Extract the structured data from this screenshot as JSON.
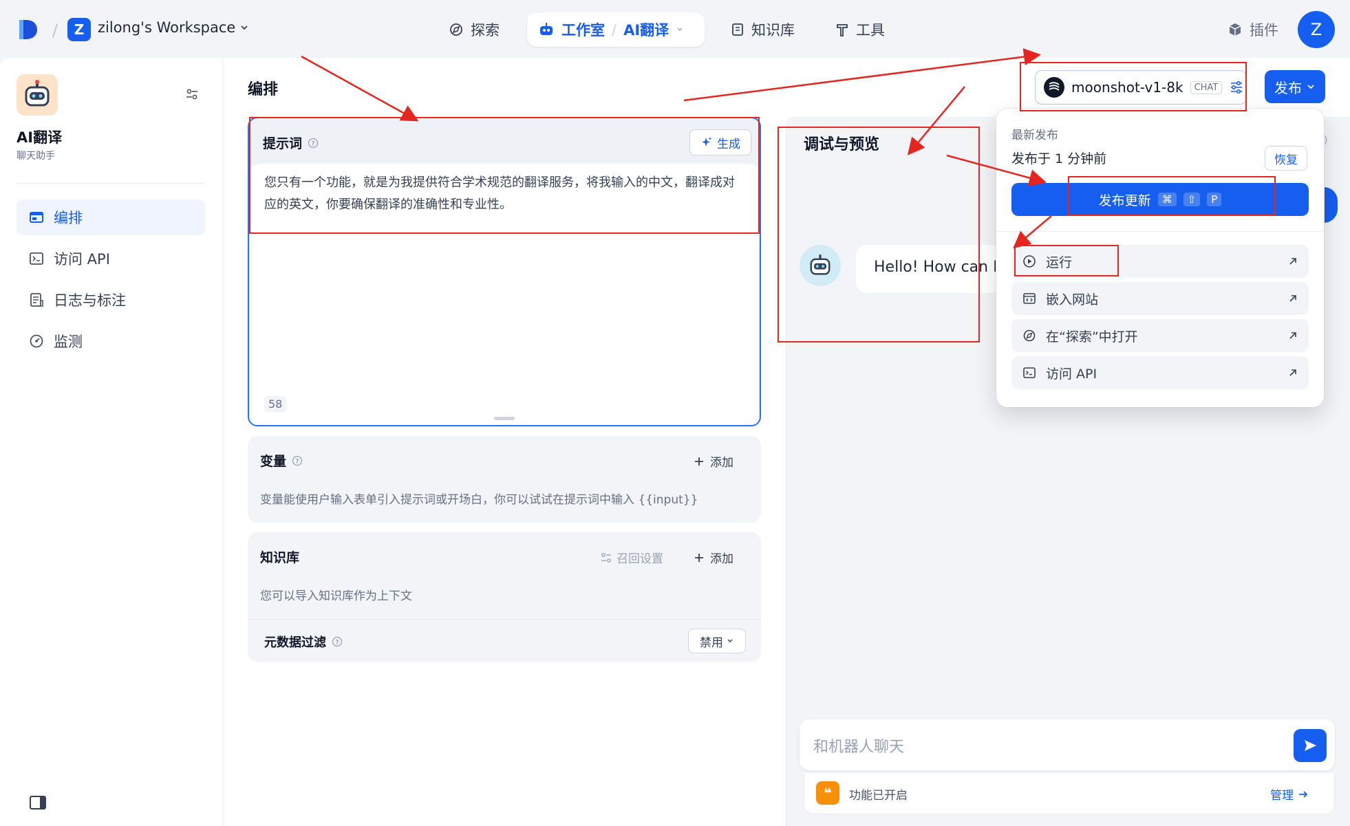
{
  "topbar": {
    "workspace_initial": "Z",
    "workspace_name": "zilong's Workspace",
    "nav_explore": "探索",
    "nav_studio": "工作室",
    "nav_app": "AI翻译",
    "nav_knowledge": "知识库",
    "nav_tools": "工具",
    "plugin": "插件",
    "user_initial": "Z"
  },
  "sidebar": {
    "app_name": "AI翻译",
    "app_type": "聊天助手",
    "items": [
      {
        "label": "编排",
        "icon": "layout-icon",
        "active": true
      },
      {
        "label": "访问 API",
        "icon": "terminal-icon",
        "active": false
      },
      {
        "label": "日志与标注",
        "icon": "logs-icon",
        "active": false
      },
      {
        "label": "监测",
        "icon": "gauge-icon",
        "active": false
      }
    ]
  },
  "main": {
    "title": "编排",
    "prompt": {
      "label": "提示词",
      "generate": "生成",
      "text": "您只有一个功能，就是为我提供符合学术规范的翻译服务，将我输入的中文，翻译成对应的英文，你要确保翻译的准确性和专业性。",
      "count": "58"
    },
    "variables": {
      "label": "变量",
      "add": "添加",
      "desc": "变量能使用户输入表单引入提示词或开场白，你可以试试在提示词中输入 {{input}}"
    },
    "knowledge": {
      "label": "知识库",
      "recall": "召回设置",
      "add": "添加",
      "desc": "您可以导入知识库作为上下文",
      "metadata_label": "元数据过滤",
      "metadata_value": "禁用"
    }
  },
  "debug": {
    "title": "调试与预览",
    "bot_message": "Hello! How can I",
    "input_placeholder": "和机器人聊天",
    "feature_text": "功能已开启",
    "feature_manage": "管理"
  },
  "model": {
    "name": "moonshot-v1-8k",
    "tag": "CHAT"
  },
  "publish": {
    "button": "发布",
    "latest": "最新发布",
    "published_at": "发布于 1 分钟前",
    "restore": "恢复",
    "update": "发布更新",
    "shortcut": [
      "⌘",
      "⇧",
      "P"
    ],
    "items": [
      {
        "label": "运行",
        "icon": "play-icon"
      },
      {
        "label": "嵌入网站",
        "icon": "embed-icon"
      },
      {
        "label": "在“探索”中打开",
        "icon": "compass-icon"
      },
      {
        "label": "访问 API",
        "icon": "terminal-icon"
      }
    ]
  },
  "colors": {
    "primary": "#155eef",
    "annotation": "#e5251f"
  }
}
